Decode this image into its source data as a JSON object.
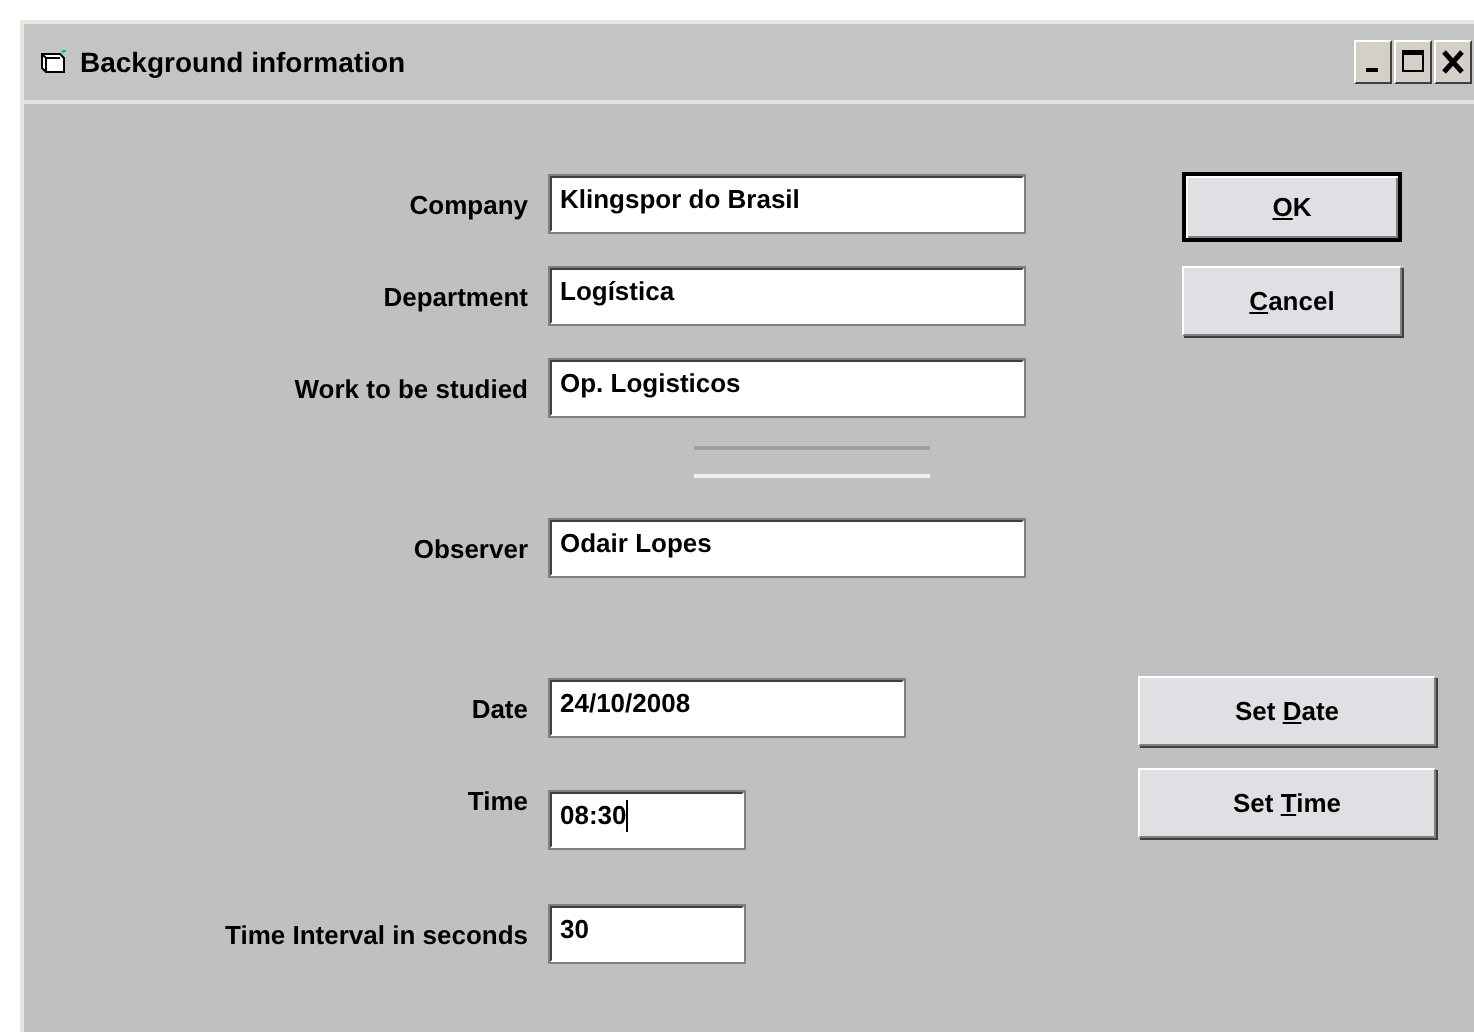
{
  "window": {
    "title": "Background information"
  },
  "fields": [
    {
      "label": "Company",
      "value": "Klingspor do Brasil",
      "focused": false
    },
    {
      "label": "Department",
      "value": "Logística",
      "focused": false
    },
    {
      "label": "Work to be studied",
      "value": "Op. Logisticos",
      "focused": false
    },
    {
      "label": "Observer",
      "value": "Odair Lopes",
      "focused": false
    },
    {
      "label": "Date",
      "value": "24/10/2008",
      "focused": false
    },
    {
      "label": "Time",
      "value": "08:30",
      "focused": true
    },
    {
      "label": "Time Interval in seconds",
      "value": "30",
      "focused": false
    }
  ],
  "buttons": [
    {
      "key": "O",
      "suffix": "K",
      "default": true
    },
    {
      "key": "C",
      "suffix": "ancel",
      "default": false
    },
    {
      "prefix": "Set ",
      "key": "D",
      "suffix": "ate",
      "default": false
    },
    {
      "prefix": "Set ",
      "key": "T",
      "suffix": "ime",
      "default": false
    }
  ]
}
